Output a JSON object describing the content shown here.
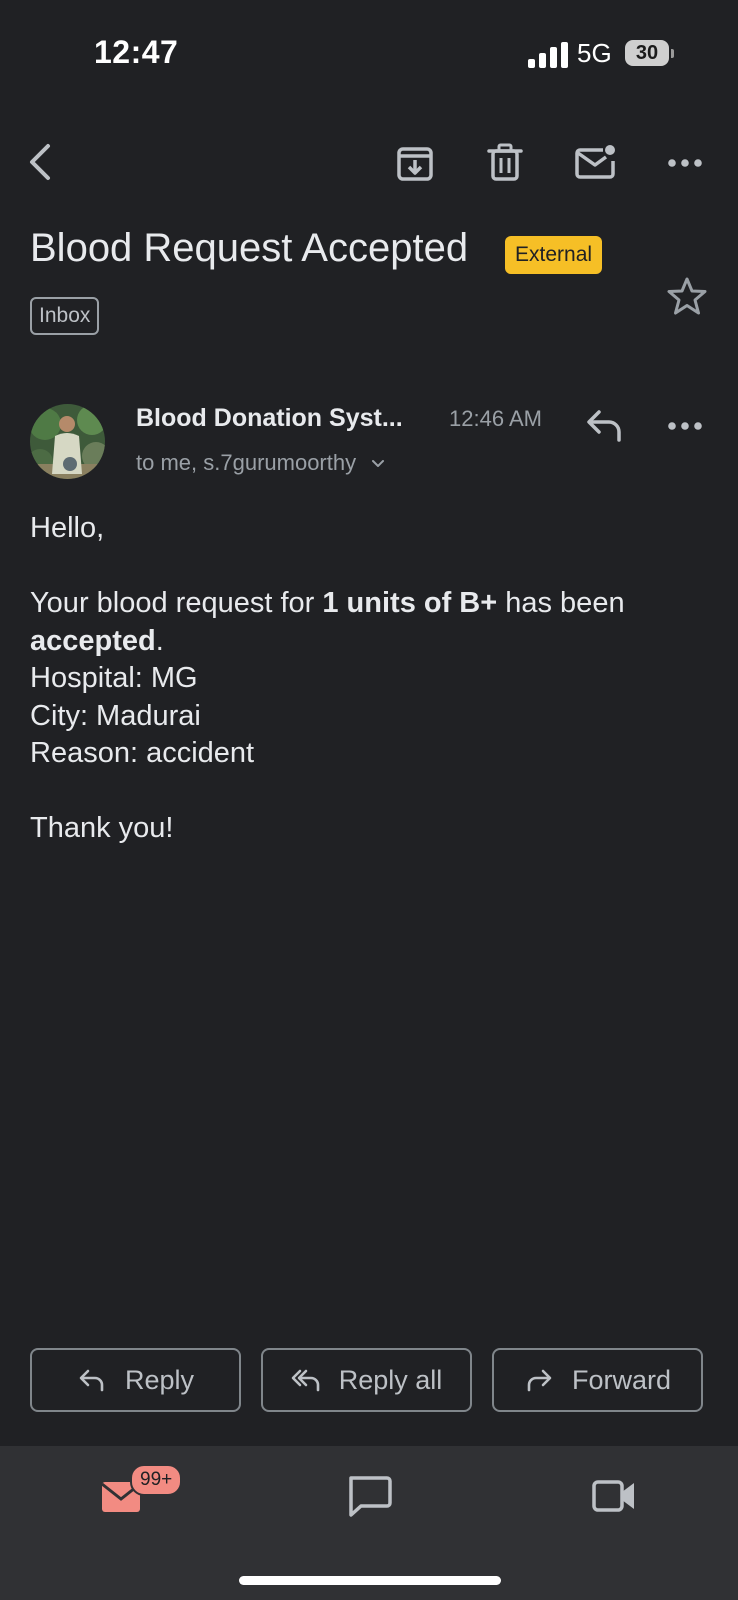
{
  "status_bar": {
    "time": "12:47",
    "network": "5G",
    "battery": "30"
  },
  "toolbar": {
    "icons": [
      "back-arrow-icon",
      "archive-icon",
      "delete-icon",
      "mark-unread-icon",
      "more-icon"
    ]
  },
  "email": {
    "subject": "Blood Request Accepted",
    "external_badge": "External",
    "label": "Inbox",
    "sender": "Blood Donation Syst...",
    "time": "12:46 AM",
    "recipients": "to me, s.7gurumoorthy",
    "body": {
      "greeting": "Hello,",
      "line1_a": "Your blood request for ",
      "line1_b": "1 units of B+",
      "line1_c": " has been ",
      "line1_d": "accepted",
      "line1_e": ".",
      "hospital": "Hospital: MG",
      "city": "City: Madurai",
      "reason": "Reason: accident",
      "closing": "Thank you!"
    }
  },
  "actions": {
    "reply": "Reply",
    "reply_all": "Reply all",
    "forward": "Forward"
  },
  "bottom_nav": {
    "mail_badge": "99+"
  },
  "colors": {
    "background": "#202124",
    "external_badge": "#f6bf26",
    "mail_accent": "#f28b82",
    "nav_bg": "#303134"
  }
}
